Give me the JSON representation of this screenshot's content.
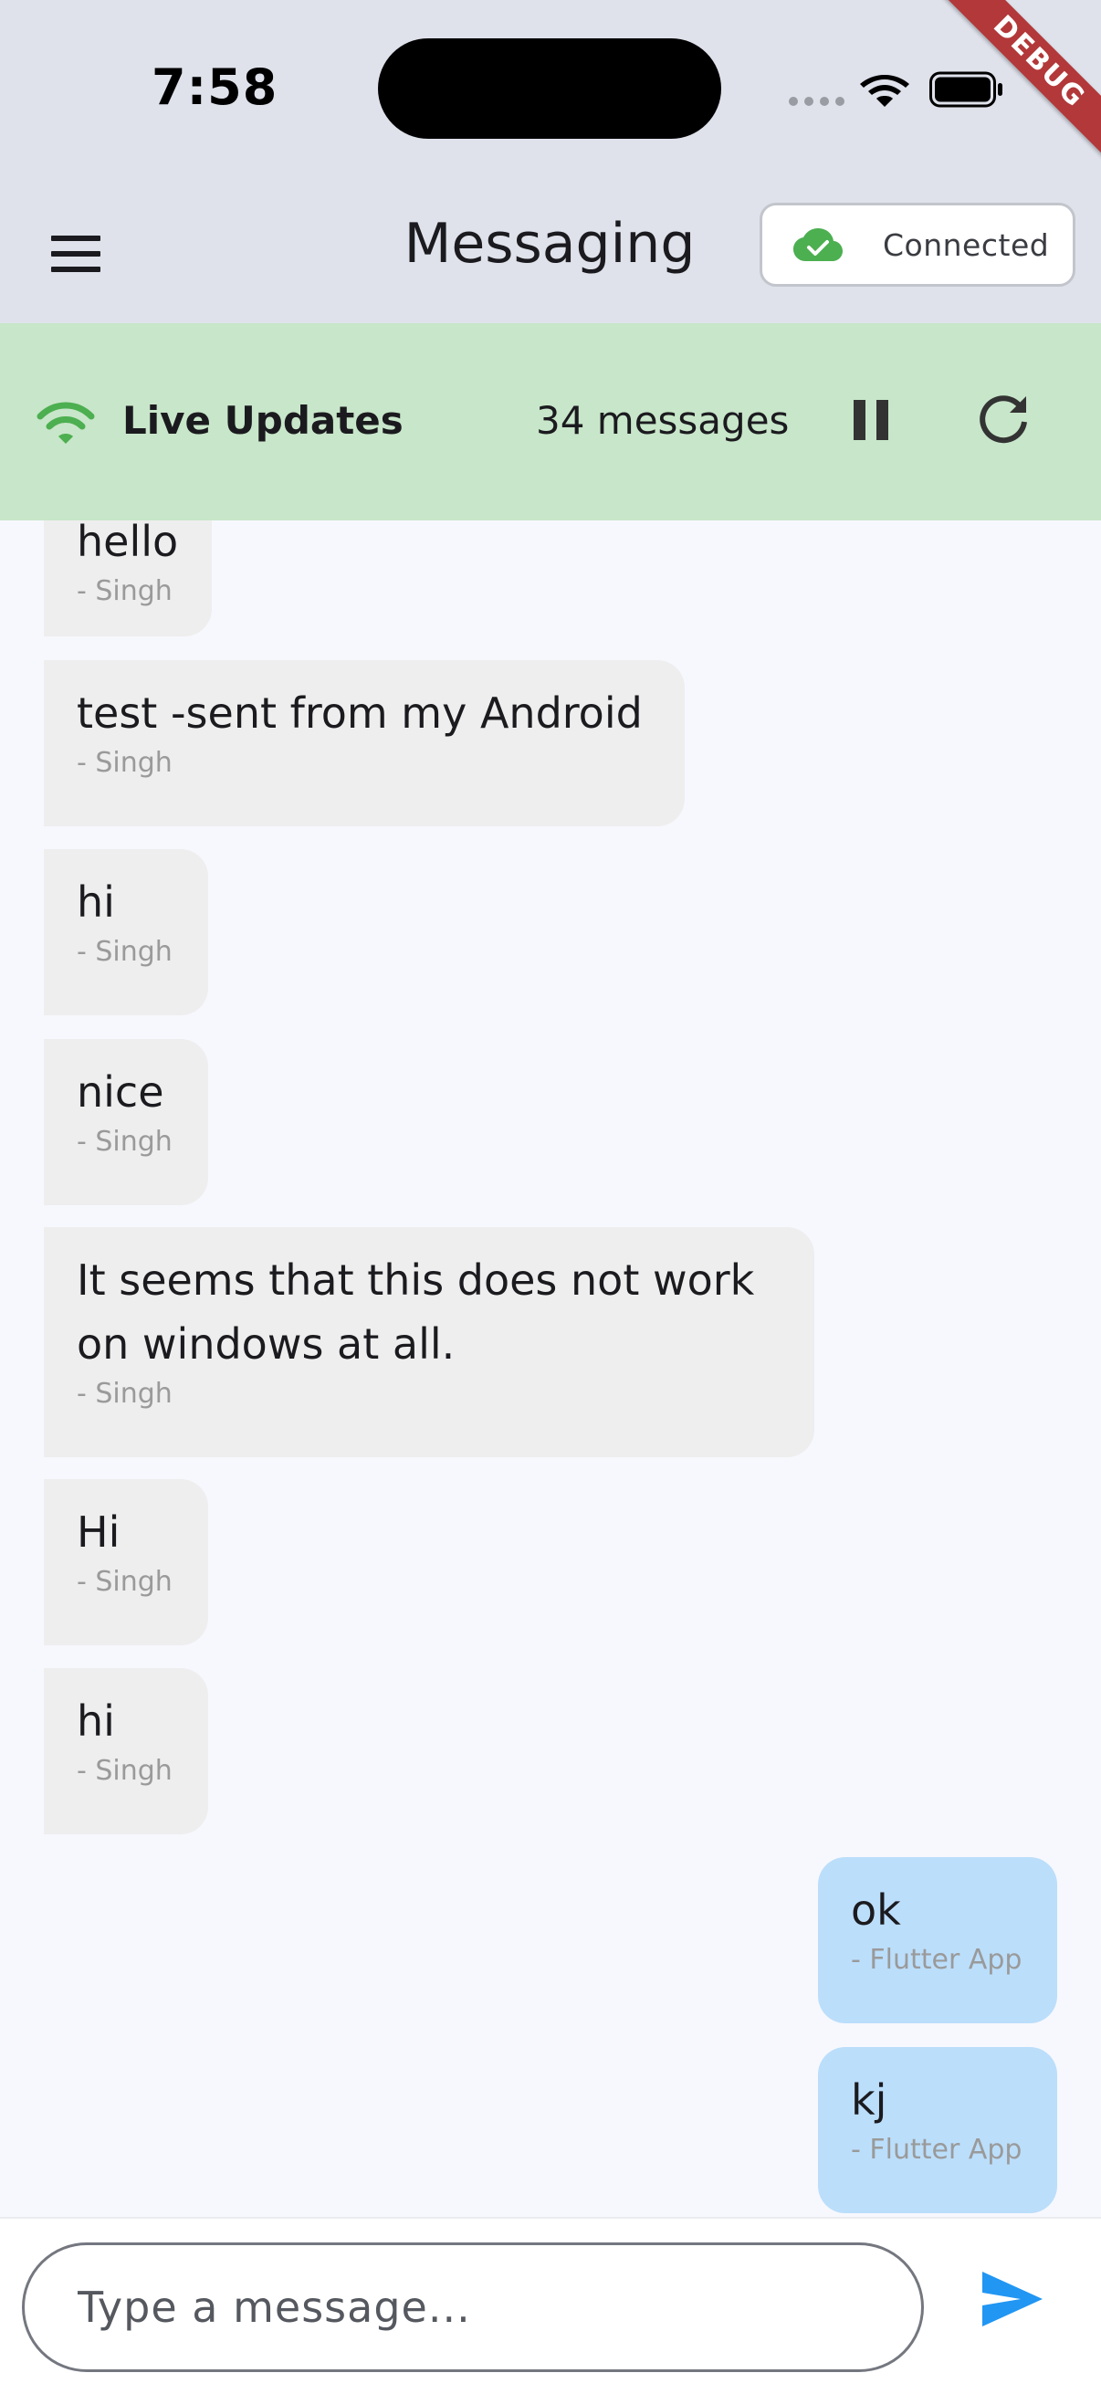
{
  "status_bar": {
    "time": "7:58",
    "debug_label": "DEBUG"
  },
  "app_bar": {
    "title": "Messaging",
    "connection_status": "Connected",
    "accent_color": "#4caf50"
  },
  "live_bar": {
    "label": "Live Updates",
    "message_count": "34 messages",
    "background": "#c8e6c9"
  },
  "messages": [
    {
      "text": "hello",
      "author": "- Singh",
      "direction": "incoming"
    },
    {
      "text": "test -sent from my Android",
      "author": "- Singh",
      "direction": "incoming"
    },
    {
      "text": "hi",
      "author": "- Singh",
      "direction": "incoming"
    },
    {
      "text": "nice",
      "author": "- Singh",
      "direction": "incoming"
    },
    {
      "text": "It seems that this does not work\non windows at all.",
      "author": "- Singh",
      "direction": "incoming"
    },
    {
      "text": "Hi",
      "author": "- Singh",
      "direction": "incoming"
    },
    {
      "text": "hi",
      "author": "- Singh",
      "direction": "incoming"
    },
    {
      "text": "ok",
      "author": "- Flutter App",
      "direction": "outgoing"
    },
    {
      "text": "kj",
      "author": "- Flutter App",
      "direction": "outgoing"
    }
  ],
  "composer": {
    "placeholder": "Type a message...",
    "value": "",
    "send_color": "#2196f3"
  }
}
